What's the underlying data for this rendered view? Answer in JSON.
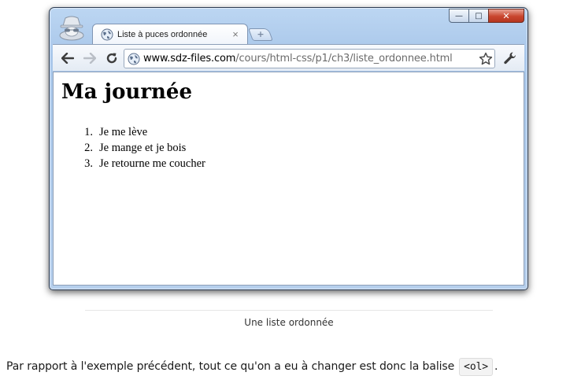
{
  "browser": {
    "tab_title": "Liste à puces ordonnée",
    "tab_close": "×",
    "new_tab": "+",
    "window_buttons": {
      "minimize": "—",
      "maximize": "□",
      "close": "✕"
    },
    "address": {
      "host": "www.sdz-files.com",
      "path": "/cours/html-css/p1/ch3/liste_ordonnee.html"
    },
    "icons": [
      "incognito-icon",
      "globe-icon",
      "back-arrow-icon",
      "forward-arrow-icon",
      "reload-icon",
      "star-icon",
      "wrench-icon"
    ]
  },
  "page": {
    "heading": "Ma journée",
    "list": [
      {
        "number": "1.",
        "text": "Je me lève"
      },
      {
        "number": "2.",
        "text": "Je mange et je bois"
      },
      {
        "number": "3.",
        "text": "Je retourne me coucher"
      }
    ]
  },
  "figure_caption": "Une liste ordonnée",
  "paragraph": {
    "text": "Par rapport à l'exemple précédent, tout ce qu'on a eu à changer est donc la balise",
    "code": "<ol>",
    "suffix": "."
  },
  "colors": {
    "window_frame": "#a9c7ea",
    "close_button": "#c9462e",
    "url_path": "#6b6b6b"
  }
}
